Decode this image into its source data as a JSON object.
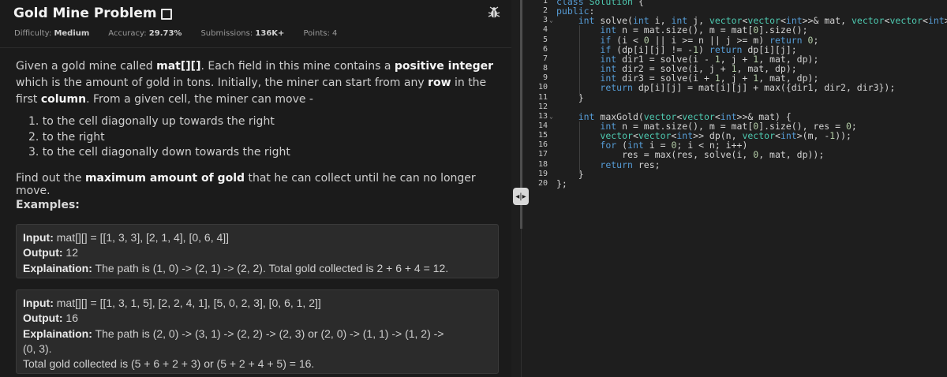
{
  "problem": {
    "title": "Gold Mine Problem",
    "difficulty_label": "Difficulty:",
    "difficulty_value": "Medium",
    "accuracy_label": "Accuracy:",
    "accuracy_value": "29.73%",
    "submissions_label": "Submissions:",
    "submissions_value": "136K+",
    "points_label": "Points:",
    "points_value": "4",
    "desc_1": "Given a gold mine called ",
    "desc_mat": "mat[][]",
    "desc_2": ". Each field in this mine contains a ",
    "desc_pos": "positive integer",
    "desc_3": " which is the amount of gold in tons. Initially, the miner can start from any ",
    "desc_row": "row",
    "desc_4": " in the first ",
    "desc_col": "column",
    "desc_5": ". From a given cell, the miner can move -",
    "moves": [
      "1. to the cell diagonally up towards the right",
      "2. to the right",
      "3. to the cell diagonally down towards the right"
    ],
    "find_1": "Find out the ",
    "find_bold": "maximum amount of gold",
    "find_2": " that he can collect until he can no longer move.",
    "examples_heading": "Examples:",
    "input_label": "Input:",
    "output_label": "Output:",
    "explanation_label": "Explaination:",
    "example1": {
      "input": " mat[][] = [[1, 3, 3], [2, 1, 4], [0, 6, 4]]",
      "output": " 12",
      "explanation": " The path is (1, 0) -> (2, 1) -> (2, 2). Total gold collected is 2 + 6 + 4 = 12."
    },
    "example2": {
      "input": " mat[][] = [[1, 3, 1, 5], [2, 2, 4, 1], [5, 0, 2, 3], [0, 6, 1, 2]]",
      "output": " 16",
      "explanation": " The path is (2, 0) -> (3, 1) -> (2, 2) -> (2, 3) or (2, 0) -> (1, 1) -> (1, 2) ->",
      "explanation_2": "(0, 3).",
      "explanation_3": "Total gold collected is (5 + 6 + 2 + 3) or (5 + 2 + 4 + 5) = 16."
    }
  },
  "icons": {
    "bookmark": "bookmark-icon",
    "bug": "bug-report-icon",
    "splitter": "resize-handle-icon"
  },
  "editor": {
    "lines": [
      {
        "n": "1",
        "fold": "",
        "html": "<span class=\"kw\">class</span> <span class=\"ty\">Solution</span> {"
      },
      {
        "n": "2",
        "fold": "",
        "html": "<span class=\"kw\">public</span>:"
      },
      {
        "n": "3",
        "fold": "⌄",
        "html": "    <span class=\"kw\">int</span> solve(<span class=\"kw\">int</span> i, <span class=\"kw\">int</span> j, <span class=\"ty\">vector</span>&lt;<span class=\"ty\">vector</span>&lt;<span class=\"kw\">int</span>&gt;&gt;&amp; mat, <span class=\"ty\">vector</span>&lt;<span class=\"ty\">vector</span>&lt;<span class=\"kw\">int</span>&gt;&gt;&amp; dp) {"
      },
      {
        "n": "4",
        "fold": "",
        "html": "        <span class=\"kw\">int</span> n = mat.size(), m = mat[<span class=\"num\">0</span>].size();"
      },
      {
        "n": "5",
        "fold": "",
        "html": "        <span class=\"kw\">if</span> (i &lt; <span class=\"num\">0</span> || i &gt;= n || j &gt;= m) <span class=\"kw\">return</span> <span class=\"num\">0</span>;"
      },
      {
        "n": "6",
        "fold": "",
        "html": "        <span class=\"kw\">if</span> (dp[i][j] != -<span class=\"num\">1</span>) <span class=\"kw\">return</span> dp[i][j];"
      },
      {
        "n": "7",
        "fold": "",
        "html": "        <span class=\"kw\">int</span> dir1 = solve(i - <span class=\"num\">1</span>, j + <span class=\"num\">1</span>, mat, dp);"
      },
      {
        "n": "8",
        "fold": "",
        "html": "        <span class=\"kw\">int</span> dir2 = solve(i, j + <span class=\"num\">1</span>, mat, dp);"
      },
      {
        "n": "9",
        "fold": "",
        "html": "        <span class=\"kw\">int</span> dir3 = solve(i + <span class=\"num\">1</span>, j + <span class=\"num\">1</span>, mat, dp);"
      },
      {
        "n": "10",
        "fold": "",
        "html": "        <span class=\"kw\">return</span> dp[i][j] = mat[i][j] + max({dir1, dir2, dir3});"
      },
      {
        "n": "11",
        "fold": "",
        "html": "    }"
      },
      {
        "n": "12",
        "fold": "",
        "html": ""
      },
      {
        "n": "13",
        "fold": "⌄",
        "html": "    <span class=\"kw\">int</span> maxGold(<span class=\"ty\">vector</span>&lt;<span class=\"ty\">vector</span>&lt;<span class=\"kw\">int</span>&gt;&gt;&amp; mat) {"
      },
      {
        "n": "14",
        "fold": "",
        "html": "        <span class=\"kw\">int</span> n = mat.size(), m = mat[<span class=\"num\">0</span>].size(), res = <span class=\"num\">0</span>;"
      },
      {
        "n": "15",
        "fold": "",
        "html": "        <span class=\"ty\">vector</span>&lt;<span class=\"ty\">vector</span>&lt;<span class=\"kw\">int</span>&gt;&gt; dp(n, <span class=\"ty\">vector</span>&lt;<span class=\"kw\">int</span>&gt;(m, -<span class=\"num\">1</span>));"
      },
      {
        "n": "16",
        "fold": "",
        "html": "        <span class=\"kw\">for</span> (<span class=\"kw\">int</span> i = <span class=\"num\">0</span>; i &lt; n; i++)"
      },
      {
        "n": "17",
        "fold": "",
        "html": "            res = max(res, solve(i, <span class=\"num\">0</span>, mat, dp));"
      },
      {
        "n": "18",
        "fold": "",
        "html": "        <span class=\"kw\">return</span> res;"
      },
      {
        "n": "19",
        "fold": "",
        "html": "    }"
      },
      {
        "n": "20",
        "fold": "",
        "html": "};"
      }
    ]
  }
}
